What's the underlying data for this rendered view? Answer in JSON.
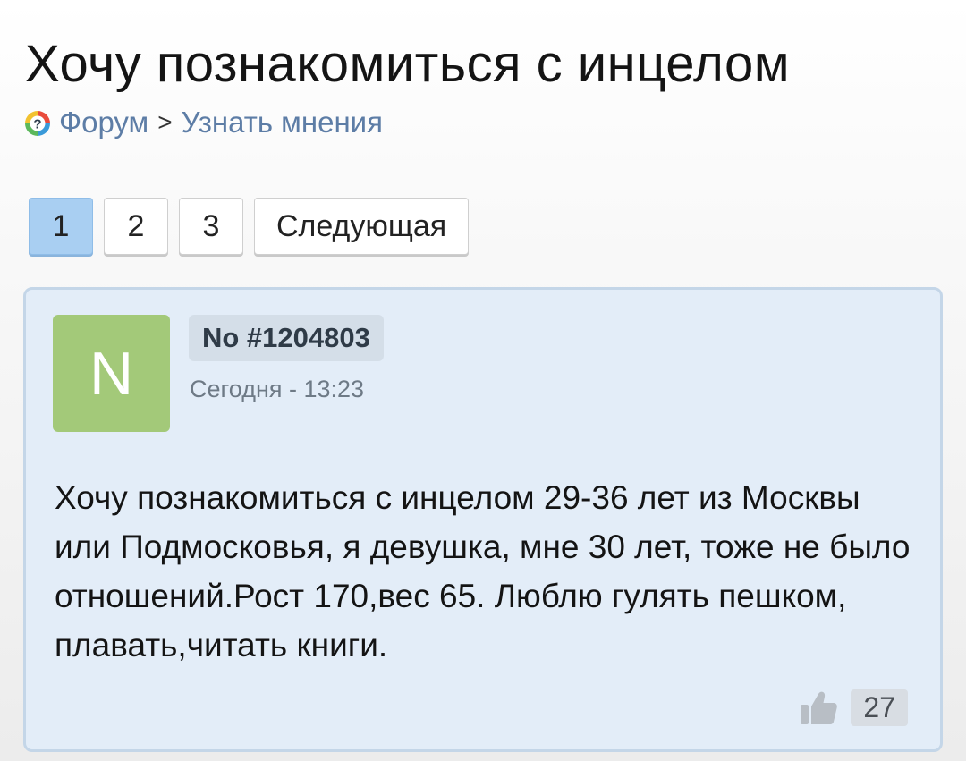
{
  "header": {
    "title": "Хочу познакомиться с инцелом"
  },
  "breadcrumb": {
    "icon": "forum-question-icon",
    "items": [
      "Форум",
      "Узнать мнения"
    ],
    "separator": ">"
  },
  "pagination": {
    "pages": [
      "1",
      "2",
      "3"
    ],
    "current": "1",
    "next_label": "Следующая"
  },
  "post": {
    "avatar_letter": "N",
    "avatar_color": "#a3c979",
    "number": "No #1204803",
    "time": "Сегодня - 13:23",
    "text": "Хочу познакомиться с инцелом 29-36 лет из Москвы или Подмосковья, я девушка, мне 30 лет, тоже не было отношений.Рост 170,вес 65. Люблю гулять пешком, плавать,читать книги.",
    "like_icon": "thumbs-up-icon",
    "likes": "27"
  },
  "colors": {
    "accent": "#5d7da6",
    "active_page": "#a9cff2",
    "post_background": "#e3edf8",
    "post_border": "#c4d6e8"
  }
}
